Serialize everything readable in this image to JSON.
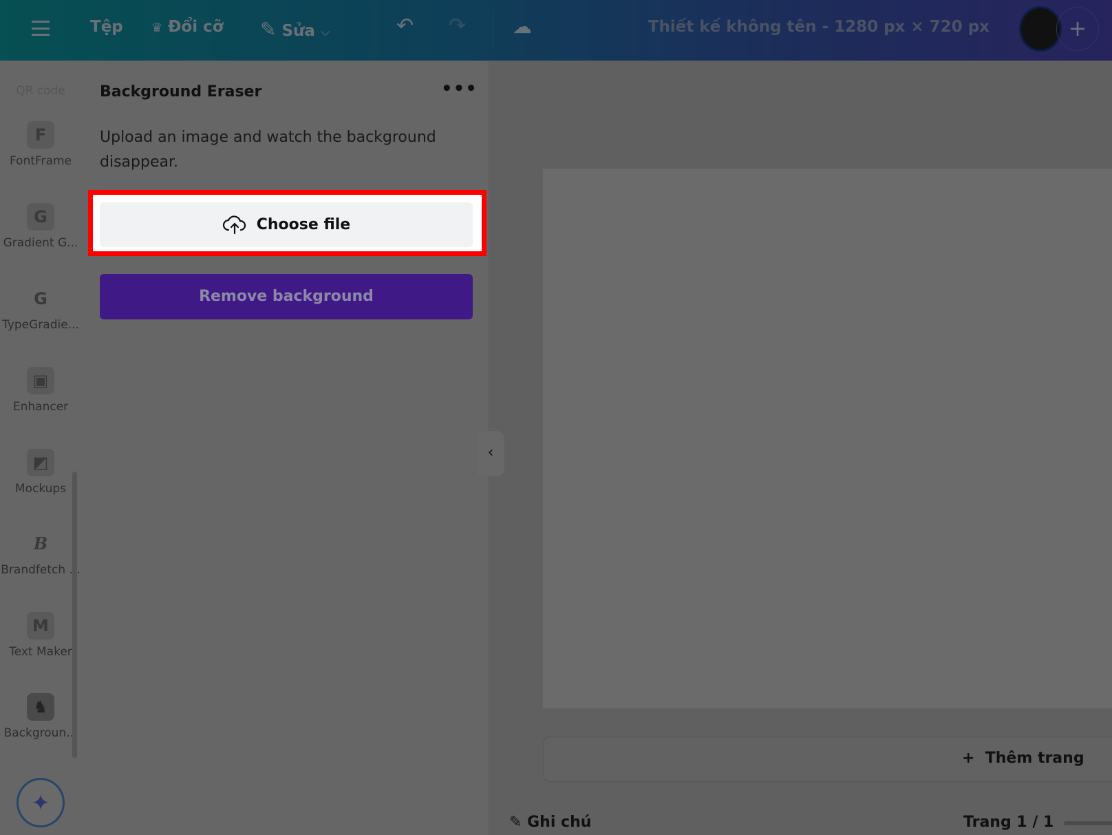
{
  "topbar": {
    "menu_icon": "hamburger-icon",
    "file": "Tệp",
    "resize": "Đổi cỡ",
    "resize_icon": "crown-icon",
    "edit": "Sửa",
    "edit_icon": "pencil-icon",
    "undo_icon": "undo-icon",
    "redo_icon": "redo-icon",
    "save_status_icon": "cloud-check-icon",
    "design_title": "Thiết kế không tên - 1280 px × 720 px",
    "add_icon": "plus-icon"
  },
  "sidebar": {
    "top_label": "QR code",
    "items": [
      {
        "label": "FontFrame",
        "glyph": "F"
      },
      {
        "label": "Gradient G...",
        "glyph": "G"
      },
      {
        "label": "TypeGradie...",
        "glyph": "G"
      },
      {
        "label": "Enhancer",
        "glyph": "▣"
      },
      {
        "label": "Mockups",
        "glyph": "◩"
      },
      {
        "label": "Brandfetch ...",
        "glyph": "B"
      },
      {
        "label": "Text Maker",
        "glyph": "M"
      },
      {
        "label": "Backgroun...",
        "glyph": "♞"
      }
    ],
    "magic_icon": "sparkles-icon"
  },
  "panel": {
    "title": "Background Eraser",
    "more_icon": "more-horizontal-icon",
    "description": "Upload an image and watch the background disappear.",
    "choose_file": "Choose file",
    "upload_icon": "cloud-upload-icon",
    "remove_bg": "Remove background"
  },
  "canvas": {
    "add_page": "Thêm trang",
    "notes": "Ghi chú",
    "page_indicator": "Trang 1 / 1"
  },
  "colors": {
    "highlight": "#ff0000",
    "primary_button": "#3f1a86",
    "topbar_start": "#064f52",
    "topbar_end": "#27235c"
  }
}
